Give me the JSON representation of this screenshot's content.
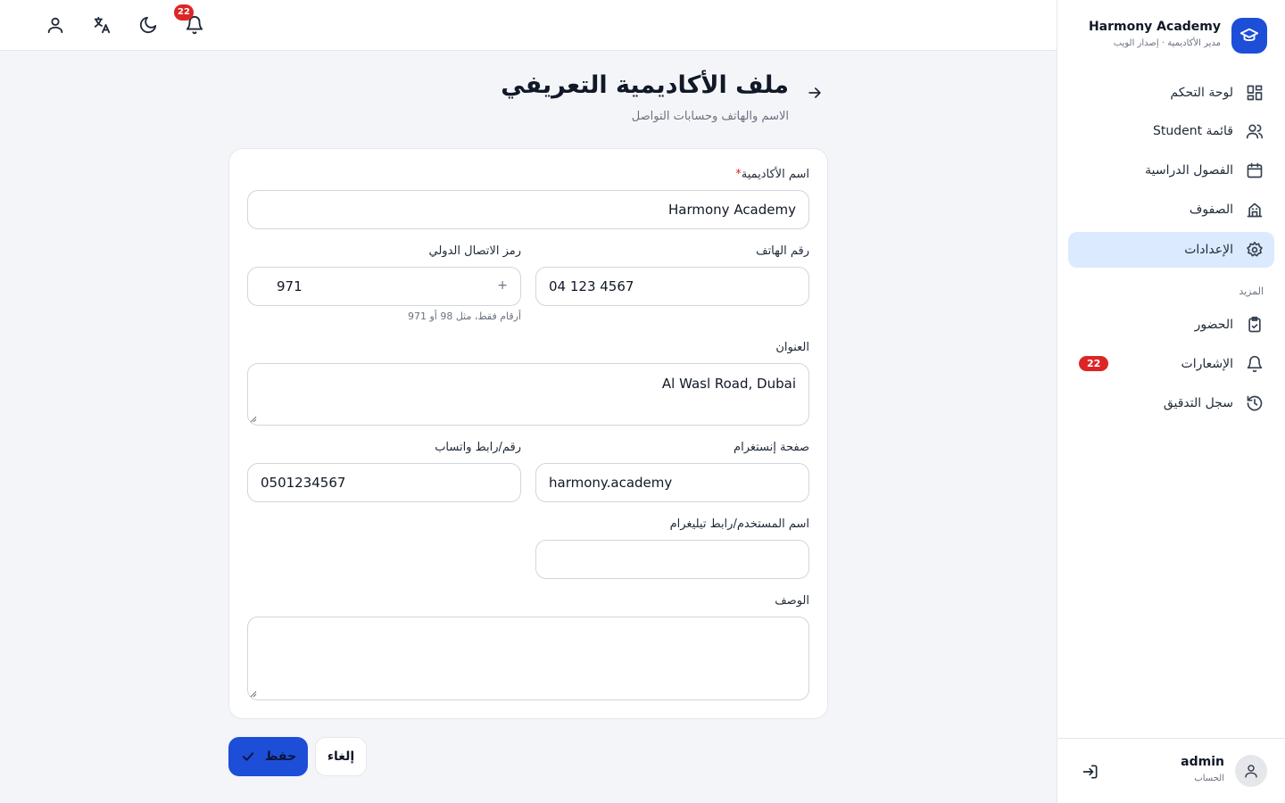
{
  "app": {
    "name": "Harmony Academy",
    "subtitle": "مدير الأكاديمية · إصدار الويب"
  },
  "sidebar": {
    "items": [
      {
        "label": "لوحة التحكم",
        "icon": "dashboard-icon"
      },
      {
        "label": "قائمة Student",
        "icon": "users-icon"
      },
      {
        "label": "الفصول الدراسية",
        "icon": "calendar-icon"
      },
      {
        "label": "الصفوف",
        "icon": "building-icon"
      },
      {
        "label": "الإعدادات",
        "icon": "gear-icon",
        "active": true
      }
    ],
    "more_label": "المزيد",
    "more_items": [
      {
        "label": "الحضور",
        "icon": "clipboard-icon"
      },
      {
        "label": "الإشعارات",
        "icon": "bell-icon",
        "badge": "22"
      },
      {
        "label": "سجل التدقيق",
        "icon": "history-icon"
      }
    ],
    "account": {
      "name": "admin",
      "sub": "الحساب"
    }
  },
  "topbar": {
    "notification_count": "22"
  },
  "page": {
    "title": "ملف الأكاديمية التعريفي",
    "subtitle": "الاسم والهاتف وحسابات التواصل"
  },
  "form": {
    "academy_name": {
      "label": "اسم الأكاديمية",
      "required_mark": "*",
      "value": "Harmony Academy"
    },
    "phone": {
      "label": "رقم الهاتف",
      "value": "04 123 4567"
    },
    "country_code": {
      "label": "رمز الاتصال الدولي",
      "prefix": "+",
      "value": "971",
      "hint": "أرقام فقط، مثل 98 أو 971"
    },
    "address": {
      "label": "العنوان",
      "value": "Al Wasl Road, Dubai"
    },
    "instagram": {
      "label": "صفحة إنستغرام",
      "value": "harmony.academy"
    },
    "whatsapp": {
      "label": "رقم/رابط واتساب",
      "value": "0501234567"
    },
    "telegram": {
      "label": "اسم المستخدم/رابط تيليغرام",
      "value": ""
    },
    "description": {
      "label": "الوصف",
      "value": ""
    }
  },
  "actions": {
    "save": "حفظ",
    "cancel": "إلغاء"
  },
  "colors": {
    "primary": "#1d4ed8",
    "active_nav_bg": "#dbeafe",
    "badge": "#dc2626",
    "page_bg": "#f3f5f9"
  }
}
